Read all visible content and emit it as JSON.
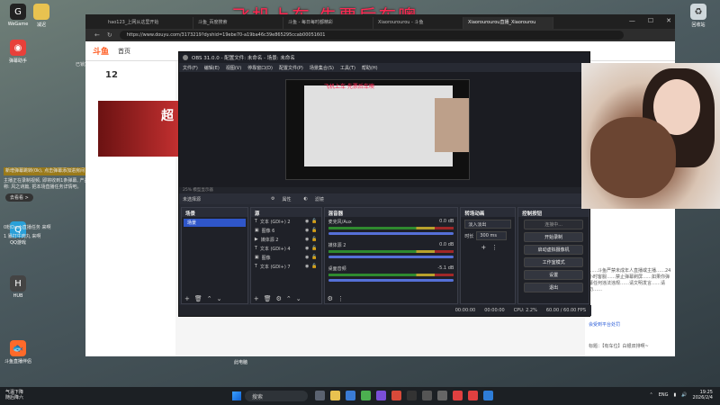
{
  "overlay": {
    "title": "飞机上车    先票后车噢"
  },
  "desktop": {
    "icons": [
      {
        "label": "WeGame"
      },
      {
        "label": "减迟"
      },
      {
        "label": "弹幕助手"
      },
      {
        "label": "Edge"
      },
      {
        "label": "QQ游戏"
      },
      {
        "label": "HUB"
      },
      {
        "label": "斗鱼直播伴侣"
      },
      {
        "label": "回收站"
      },
      {
        "label": "此电脑"
      }
    ]
  },
  "chat": {
    "badge": "已锁定",
    "messages": [
      "新增弹幕跳转(0k), 点击弹幕添加进房间",
      "主播正在录制视频, 即将收到1条弹幕, 产品名称: 风之诗篇, 把本场直播任务详情吧。",
      "0粉Dash直播任务 来啊",
      "1 暴打牛肉丸 来啊"
    ],
    "button": "去看看 >"
  },
  "browser": {
    "tabs": [
      {
        "label": "hao123_上网从这里开始"
      },
      {
        "label": "斗鱼_百度搜索"
      },
      {
        "label": "斗鱼 - 每日每时都精彩"
      },
      {
        "label": "Xiaorourourou - 斗鱼"
      },
      {
        "label": "Xiaorourourou直播_Xiaorourou"
      }
    ],
    "url": "https://www.douyu.com/3173219?dyshid=19ebe70-a19ba46c39e865295ccab00051601"
  },
  "site": {
    "logo": "斗鱼",
    "nav_home": "首页",
    "level": "12",
    "banner_text": "超",
    "right_text": "……斗鱼严禁未成年人直播或主播……24小时客服……禁止弹幕刷屏……如果你弹幕任何违法违规……请文明发言……请勿……",
    "right_text2": "会受到平台处罚",
    "right_text3": "标题：【有车位】白银双排啊~",
    "taskbar_label": "此电脑"
  },
  "obs": {
    "title": "OBS 31.0.0 - 配置文件: 未命名 - 场景: 未命名",
    "menu": [
      "文件(F)",
      "编辑(E)",
      "视图(V)",
      "停靠窗口(D)",
      "配置文件(P)",
      "场景集合(S)",
      "工具(T)",
      "帮助(H)"
    ],
    "nested_title": "飞机上车    先票后车噢",
    "strip_text": "25% 模型显示器",
    "no_source": "未选择源",
    "props_label": "属性",
    "filters_label": "滤镜",
    "docks": {
      "scenes": "场景",
      "sources": "源",
      "mixer": "混音器",
      "transitions": "转场动画",
      "controls": "控制按钮"
    },
    "scene_item": "场景",
    "sources": [
      {
        "label": "文本 (GDI+) 2"
      },
      {
        "label": "图像 6"
      },
      {
        "label": "媒体源 2"
      },
      {
        "label": "文本 (GDI+) 4"
      },
      {
        "label": "图像"
      },
      {
        "label": "文本 (GDI+) 7"
      }
    ],
    "mixer": [
      {
        "name": "麦克风/Aux",
        "db": "0.0 dB"
      },
      {
        "name": "媒体源 2",
        "db": "0.0 dB"
      },
      {
        "name": "桌面音频",
        "db": "-5.1 dB"
      }
    ],
    "transitions": {
      "type": "淡入淡出",
      "duration_label": "时长",
      "duration": "300 ms"
    },
    "controls": [
      "开始直播",
      "开始录制",
      "启动虚拟摄像机",
      "工作室模式",
      "设置",
      "退出"
    ],
    "controls_disabled": "连接中...",
    "status": {
      "time1": "00:00:00",
      "time2": "00:00:00",
      "cpu": "CPU: 2.2%",
      "fps": "60.00 / 60.00 FPS"
    }
  },
  "taskbar": {
    "weather_line1": "气温下降",
    "weather_line2": "随后降六",
    "search": "搜索",
    "lang": "ENG",
    "time": "19:25",
    "date": "2026/2/4"
  }
}
